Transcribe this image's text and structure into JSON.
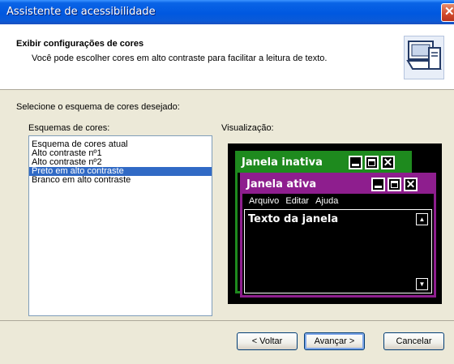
{
  "window": {
    "title": "Assistente de acessibilidade",
    "close_glyph": "✕"
  },
  "header": {
    "title": "Exibir configurações de cores",
    "description": "Você pode escolher cores em alto contraste para facilitar a leitura de texto.",
    "icon": "wizard-computer-icon"
  },
  "prompt": "Selecione o esquema de cores desejado:",
  "schemes": {
    "label": "Esquemas de cores:",
    "items": [
      "Esquema de cores atual",
      "Alto contraste nº1",
      "Alto contraste nº2",
      "Preto em alto contraste",
      "Branco em alto contraste"
    ],
    "selected_index": 3
  },
  "preview": {
    "label": "Visualização:",
    "inactive_title": "Janela inativa",
    "active_title": "Janela ativa",
    "menu": [
      "Arquivo",
      "Editar",
      "Ajuda"
    ],
    "client_text": "Texto da janela",
    "inactive_color": "#1e8a1e",
    "active_color": "#8e1e8e",
    "background_color": "#000000"
  },
  "buttons": {
    "back": "< Voltar",
    "next": "Avançar >",
    "cancel": "Cancelar"
  },
  "colors": {
    "selection": "#316ac5",
    "titlebar": "#0058e0",
    "dialog_bg": "#ece9d8"
  }
}
